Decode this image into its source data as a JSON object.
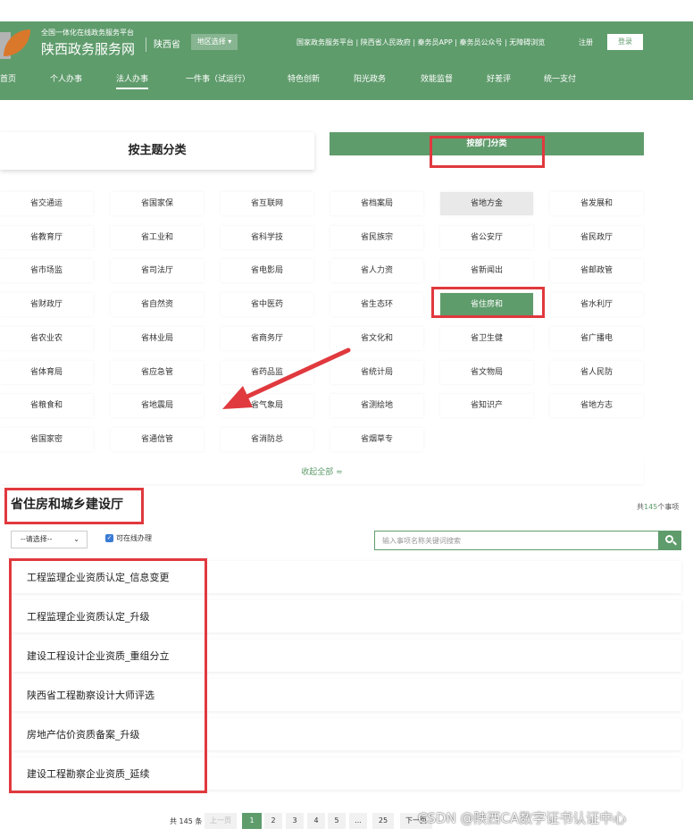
{
  "header": {
    "subtitle": "全国一体化在线政务服务平台",
    "title": "陕西政务服务网",
    "province": "陕西省",
    "region_select": "地区选择",
    "top_links": "国家政务服务平台 | 陕西省人民政府 | 秦务员APP | 秦务员公众号 | 无障碍浏览",
    "register": "注册",
    "login": "登录"
  },
  "nav": {
    "items": [
      "首页",
      "个人办事",
      "法人办事",
      "一件事（试运行）",
      "特色创新",
      "阳光政务",
      "效能监督",
      "好差评",
      "统一支付"
    ],
    "active_index": 2
  },
  "category_tabs": {
    "theme": "按主题分类",
    "department": "按部门分类",
    "selected": "按部门分类"
  },
  "departments": [
    "省交通运",
    "省国家保",
    "省互联网",
    "省档案局",
    "省地方金",
    "省发展和",
    "省教育厅",
    "省工业和",
    "省科学技",
    "省民族宗",
    "省公安厅",
    "省民政厅",
    "省市场监",
    "省司法厅",
    "省电影局",
    "省人力资",
    "省新闻出",
    "省邮政管",
    "省财政厅",
    "省自然资",
    "省中医药",
    "省生态环",
    "省住房和",
    "省水利厅",
    "省农业农",
    "省林业局",
    "省商务厅",
    "省文化和",
    "省卫生健",
    "省广播电",
    "省体育局",
    "省应急管",
    "省药品监",
    "省统计局",
    "省文物局",
    "省人民防",
    "省粮食和",
    "省地震局",
    "省气象局",
    "省测绘地",
    "省知识产",
    "省地方志",
    "省国家密",
    "省通信管",
    "省消防总",
    "省烟草专"
  ],
  "department_highlighted": "省地方金",
  "department_selected": "省住房和",
  "collapse_label": "收起全部 ≈",
  "section": {
    "title": "省住房和城乡建设厅",
    "total_prefix": "共",
    "total_number": "145",
    "total_suffix": "个事项",
    "filter_select": "--请选择--",
    "online_checkbox_label": "可在线办理",
    "online_checked": true,
    "search_placeholder": "输入事项名称关键词搜索"
  },
  "items": [
    "工程监理企业资质认定_信息变更",
    "工程监理企业资质认定_升级",
    "建设工程设计企业资质_重组分立",
    "陕西省工程勘察设计大师评选",
    "房地产估价资质备案_升级",
    "建设工程勘察企业资质_延续"
  ],
  "pagination": {
    "total": "共 145 条",
    "prev": "上一页",
    "pages": [
      "1",
      "2",
      "3",
      "4",
      "5",
      "...",
      "25"
    ],
    "current": "1",
    "next": "下一页"
  },
  "watermark": "CSDN @陕西CA数字证书认证中心",
  "icons": {
    "logo": "orange-leaf-icon",
    "search": "search-icon",
    "dropdown": "chevron-down-icon",
    "annotation_arrow": "red-arrow"
  },
  "colors": {
    "brand_green": "#5f9c6c",
    "annotation_red": "#e0393e",
    "watermark_white": "#ffffff"
  }
}
